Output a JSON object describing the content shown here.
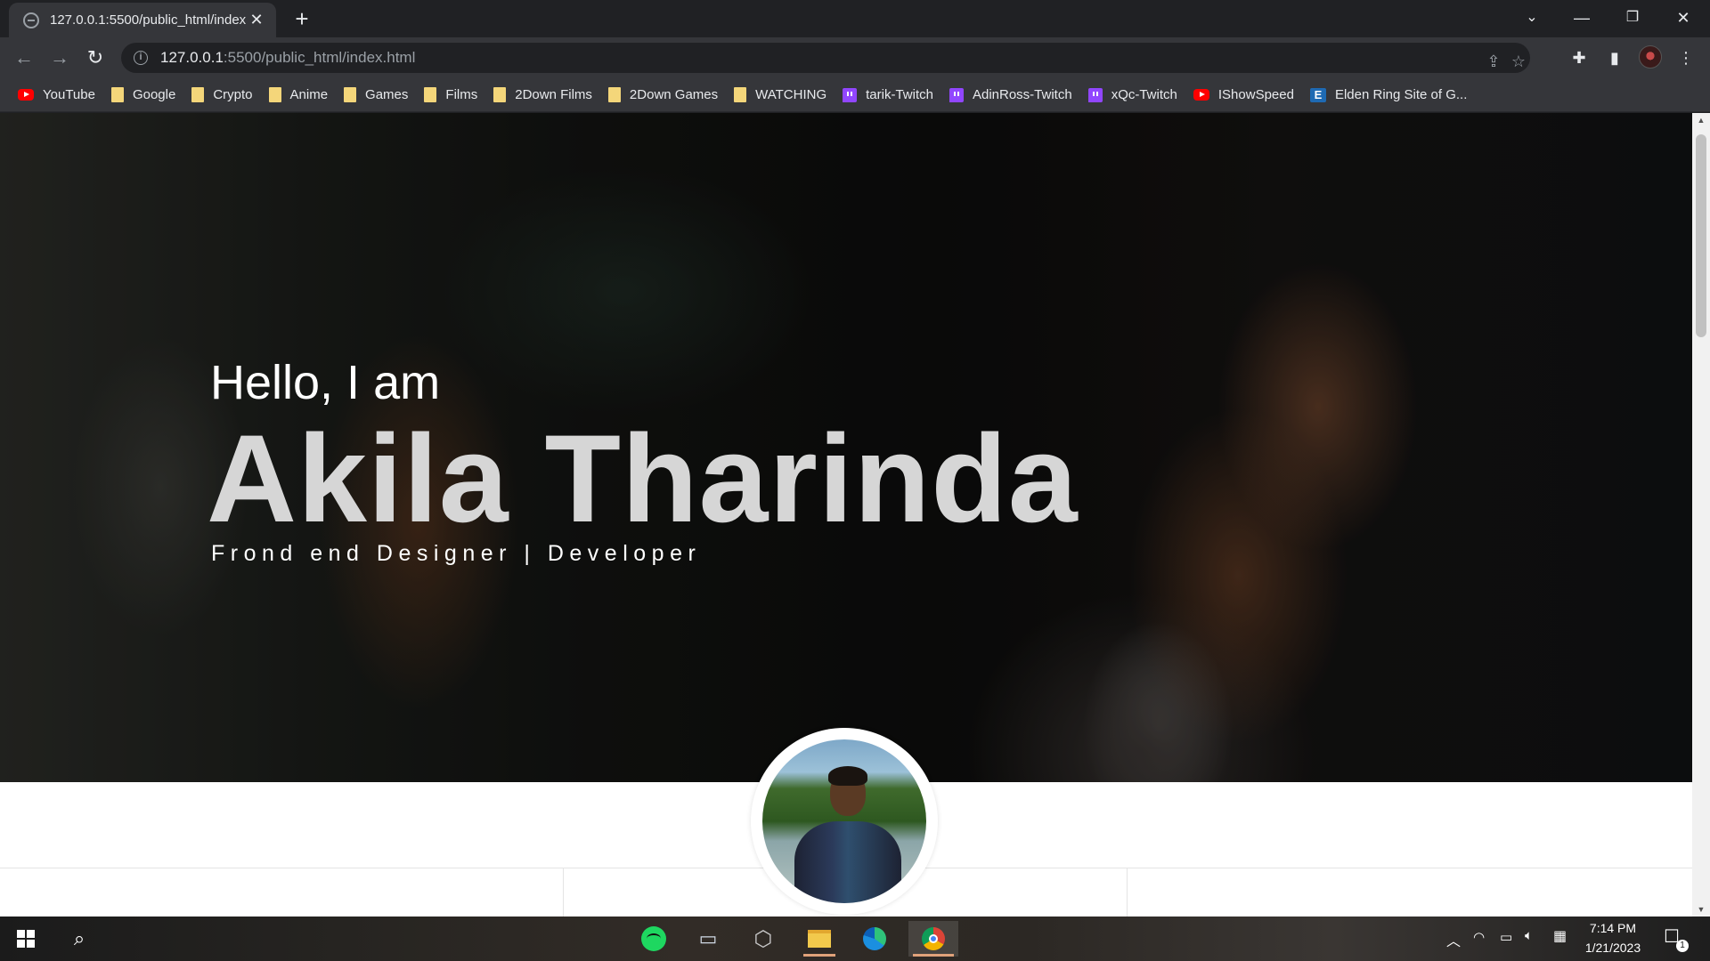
{
  "browser": {
    "tab_title": "127.0.0.1:5500/public_html/index.html",
    "new_tab": "+",
    "url_host": "127.0.0.1",
    "url_path": ":5500/public_html/index.html"
  },
  "bookmarks": [
    {
      "label": "YouTube",
      "icon": "youtube-icon"
    },
    {
      "label": "Google",
      "icon": "folder-icon"
    },
    {
      "label": "Crypto",
      "icon": "folder-icon"
    },
    {
      "label": "Anime",
      "icon": "folder-icon"
    },
    {
      "label": "Games",
      "icon": "folder-icon"
    },
    {
      "label": "Films",
      "icon": "folder-icon"
    },
    {
      "label": "2Down Films",
      "icon": "folder-icon"
    },
    {
      "label": "2Down Games",
      "icon": "folder-icon"
    },
    {
      "label": "WATCHING",
      "icon": "folder-icon"
    },
    {
      "label": "tarik-Twitch",
      "icon": "twitch-icon"
    },
    {
      "label": "AdinRoss-Twitch",
      "icon": "twitch-icon"
    },
    {
      "label": "xQc-Twitch",
      "icon": "twitch-icon"
    },
    {
      "label": "IShowSpeed",
      "icon": "youtube-icon"
    },
    {
      "label": "Elden Ring Site of G...",
      "icon": "elden-ring-icon"
    }
  ],
  "hero": {
    "greeting": "Hello, I am",
    "name": "Akila Tharinda",
    "role": "Frond end Designer | Developer"
  },
  "taskbar": {
    "time": "7:14 PM",
    "date": "1/21/2023",
    "notification_count": "1"
  },
  "colors": {
    "browser_bg": "#202124",
    "toolbar_bg": "#35363a",
    "hero_name": "#d6d6d6",
    "twitch": "#9146ff",
    "youtube": "#ff0000",
    "spotify": "#1ed760"
  }
}
